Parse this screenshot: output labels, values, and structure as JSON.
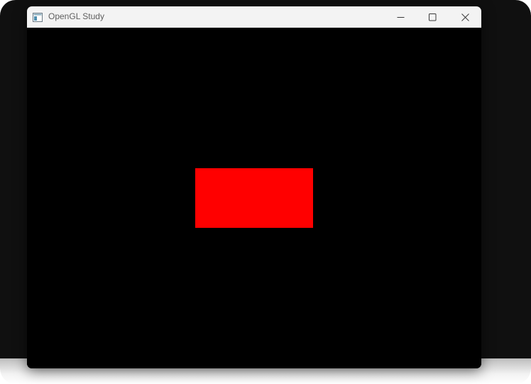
{
  "window": {
    "title": "OpenGL Study",
    "app_icon": "app-window-icon"
  },
  "caption_buttons": {
    "minimize": "minimize-icon",
    "maximize": "maximize-icon",
    "close": "close-icon"
  },
  "canvas": {
    "background": "#000000",
    "shape": {
      "type": "rectangle",
      "color": "#ff0000"
    }
  },
  "colors": {
    "titlebar": "#f3f3f3",
    "title_text": "#5f5f5f"
  }
}
